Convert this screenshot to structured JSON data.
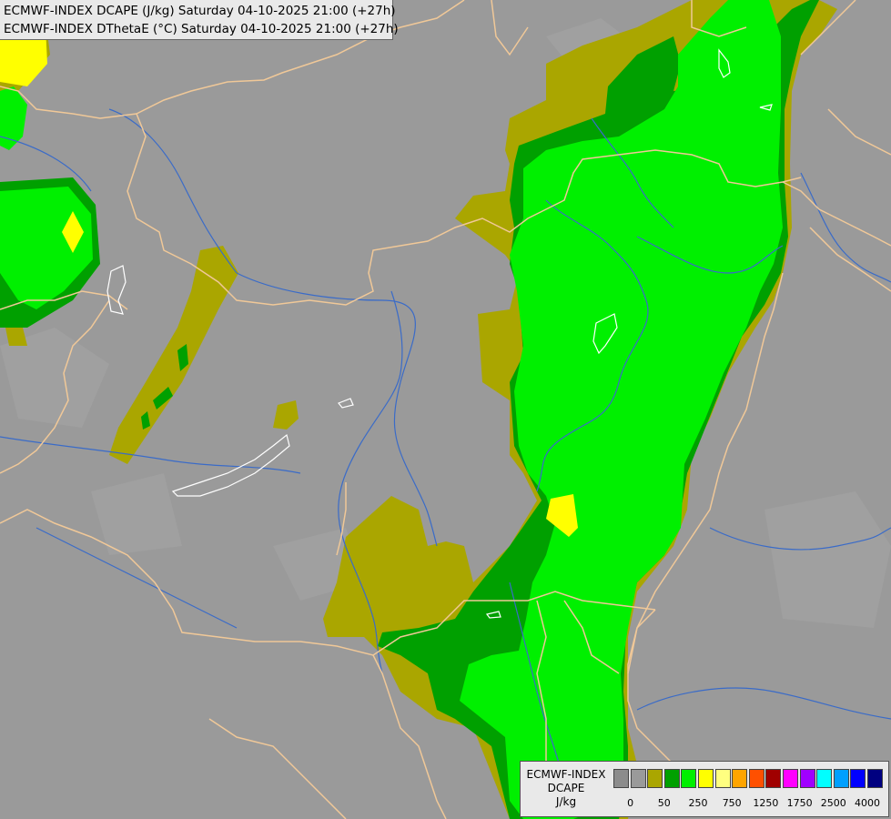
{
  "header": {
    "line1": "ECMWF-INDEX DCAPE (J/kg) Saturday 04-10-2025 21:00 (+27h)",
    "line2": "ECMWF-INDEX DThetaE (°C) Saturday 04-10-2025 21:00 (+27h)"
  },
  "legend": {
    "title_line1": "ECMWF-INDEX",
    "title_line2": "DCAPE",
    "title_line3": "J/kg",
    "colors": [
      "#8c8c8c",
      "#9a9a9a",
      "#aaa600",
      "#00a000",
      "#00f000",
      "#ffff00",
      "#ffff80",
      "#ffa500",
      "#ff5000",
      "#a00000",
      "#ff00ff",
      "#a000ff",
      "#00ffff",
      "#00a0ff",
      "#0000ff",
      "#000080"
    ],
    "ticks": [
      "0",
      "50",
      "250",
      "750",
      "1250",
      "1750",
      "2500",
      "4000"
    ]
  },
  "colors": {
    "background": "#9a9a9a",
    "border": "#f0c898",
    "river": "#3a6bc8",
    "lake": "#ffffff",
    "olive": "#aaa600",
    "dark_green": "#00a000",
    "bright_green": "#00f000",
    "yellow": "#ffff00"
  }
}
